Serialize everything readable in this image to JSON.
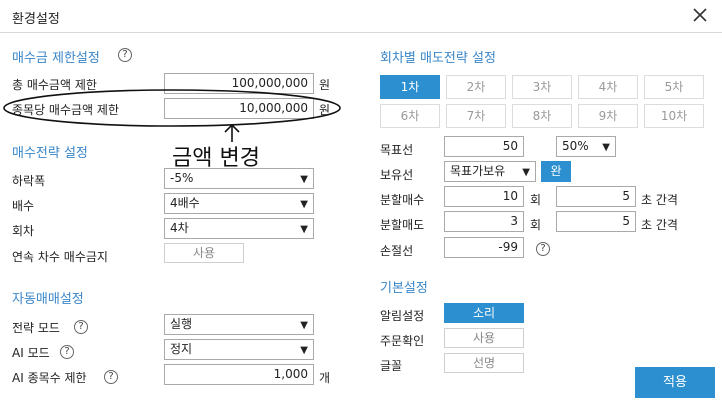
{
  "window": {
    "title": "환경설정"
  },
  "buy_limit": {
    "section_title": "매수금 제한설정",
    "total_label": "총 매수금액 제한",
    "total_value": "100,000,000",
    "per_item_label": "종목당 매수금액 제한",
    "per_item_value": "10,000,000",
    "unit": "원",
    "annotation": "금액 변경"
  },
  "buy_strategy": {
    "section_title": "매수전략 설정",
    "drop_label": "하락폭",
    "drop_value": "-5%",
    "multiplier_label": "배수",
    "multiplier_value": "4배수",
    "rounds_label": "회차",
    "rounds_value": "4차",
    "consec_label": "연속 차수 매수금지",
    "consec_value": "사용"
  },
  "auto_trade": {
    "section_title": "자동매매설정",
    "strategy_mode_label": "전략 모드",
    "strategy_mode_value": "실행",
    "ai_mode_label": "AI 모드",
    "ai_mode_value": "정지",
    "ai_limit_label": "AI 종목수 제한",
    "ai_limit_value": "1,000",
    "ai_limit_unit": "개"
  },
  "sell_strategy": {
    "section_title": "회차별 매도전략 설정",
    "tabs": [
      "1차",
      "2차",
      "3차",
      "4차",
      "5차",
      "6차",
      "7차",
      "8차",
      "9차",
      "10차"
    ],
    "active_tab": 0,
    "target_label": "목표선",
    "target_value": "50",
    "target_pct": "50%",
    "hold_label": "보유선",
    "hold_value": "목표가보유",
    "hold_btn": "완",
    "split_buy_label": "분할매수",
    "split_buy_count": "10",
    "split_buy_interval": "5",
    "split_sell_label": "분할매도",
    "split_sell_count": "3",
    "split_sell_interval": "5",
    "count_unit": "회",
    "interval_unit": "초 간격",
    "stoploss_label": "손절선",
    "stoploss_value": "-99"
  },
  "basic": {
    "section_title": "기본설정",
    "alarm_label": "알림설정",
    "alarm_value": "소리",
    "order_confirm_label": "주문확인",
    "order_confirm_value": "사용",
    "font_label": "글꼴",
    "font_value": "선명"
  },
  "apply_button": "적용"
}
